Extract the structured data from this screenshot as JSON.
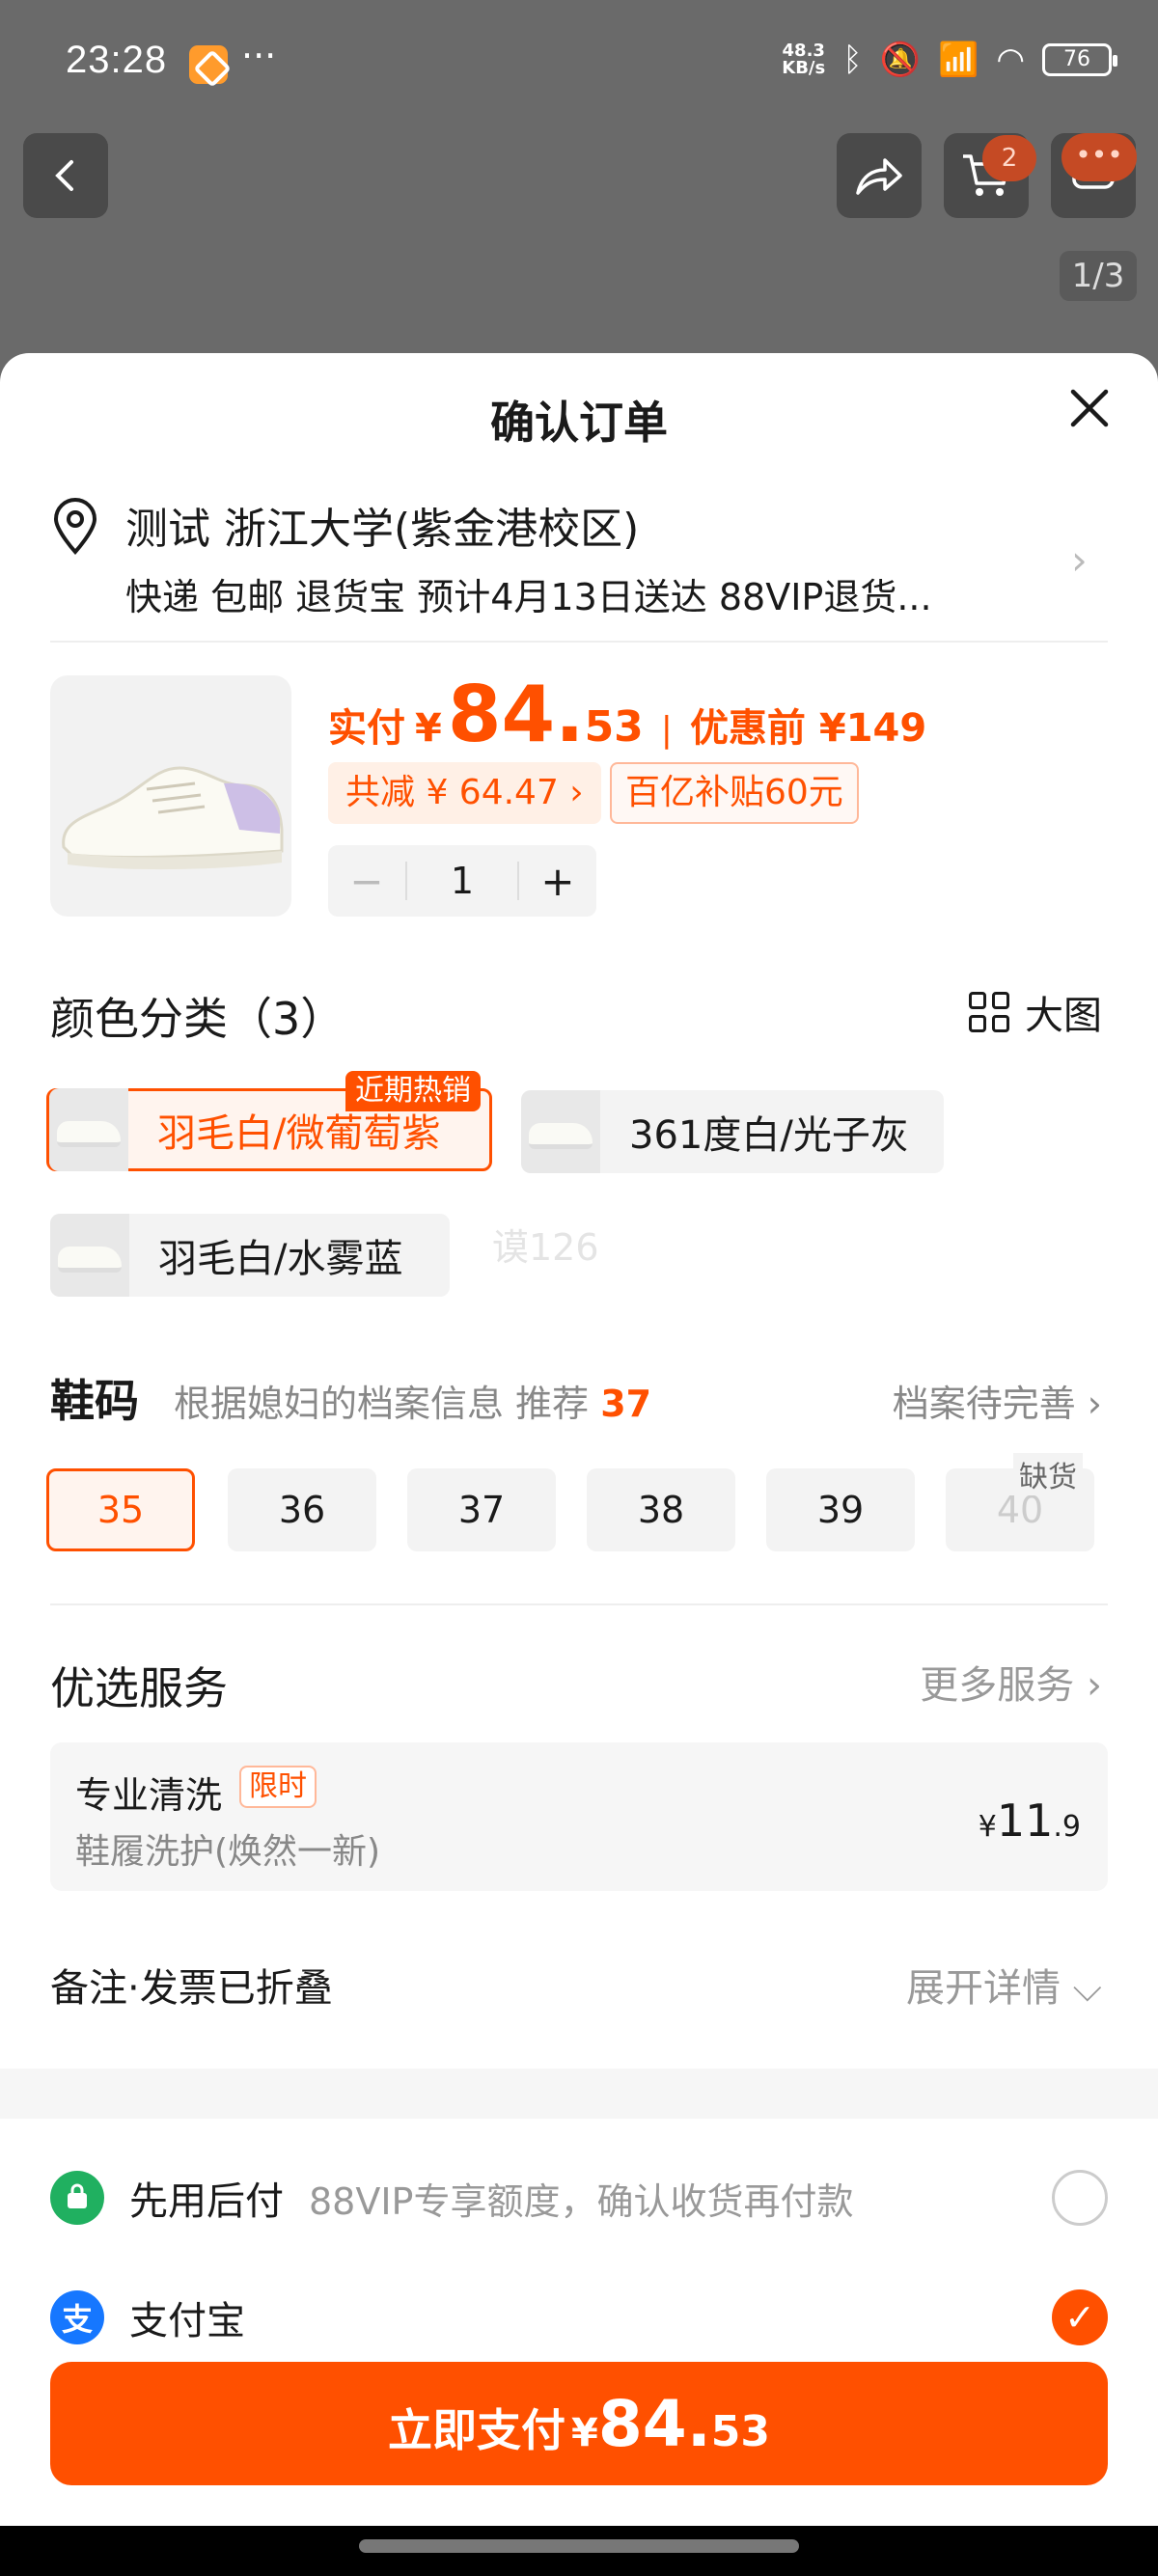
{
  "status_bar": {
    "time": "23:28",
    "dots": "···",
    "net_speed_value": "48.3",
    "net_speed_unit": "KB/s",
    "battery": "76"
  },
  "header": {
    "cart_count": "2",
    "image_counter": "1/3"
  },
  "sheet": {
    "title": "确认订单",
    "address": {
      "name": "测试 浙江大学(紫金港校区)",
      "delivery": "快递 包邮 退货宝 预计4月13日送达 88VIP退货..."
    },
    "product": {
      "paid_label": "实付",
      "currency": "¥",
      "paid_int": "84.",
      "paid_dec": "53",
      "separator": "|",
      "original": "优惠前 ¥149",
      "discount": "共减 ¥ 64.47 ›",
      "subsidy": "百亿补贴60元",
      "quantity": "1",
      "minus": "−",
      "plus": "+"
    },
    "color": {
      "title": "颜色分类（3）",
      "bigpic_label": "大图",
      "hot_tag": "近期热销",
      "options": [
        "羽毛白/微葡萄紫",
        "361度白/光子灰",
        "羽毛白/水雾蓝"
      ],
      "watermark": "谟126"
    },
    "size": {
      "label": "鞋码",
      "hint": "根据媳妇的档案信息 推荐",
      "recommended": "37",
      "profile_link": "档案待完善 ›",
      "oos_tag": "缺货",
      "options": [
        "35",
        "36",
        "37",
        "38",
        "39",
        "40"
      ]
    },
    "services": {
      "title": "优选服务",
      "more": "更多服务 ›",
      "item": {
        "name": "专业清洗",
        "tag": "限时",
        "desc": "鞋履洗护(焕然一新)",
        "price_yen": "¥",
        "price_int": "11",
        "price_dec": ".9"
      }
    },
    "notes": {
      "label": "备注·发票已折叠",
      "expand": "展开详情 ⌵"
    },
    "payment": {
      "methods": [
        {
          "name": "先用后付",
          "desc": "88VIP专享额度，确认收货再付款",
          "selected": false
        },
        {
          "name": "支付宝",
          "desc": "",
          "selected": true
        }
      ]
    },
    "pay_button": {
      "label": "立即支付",
      "currency": "¥",
      "amount_int": "84.",
      "amount_dec": "53"
    }
  },
  "colors": {
    "accent": "#ff5000",
    "sheet_bg": "#ffffff",
    "overlay": "#6a6a6a"
  },
  "icons": [
    "back-icon",
    "share-icon",
    "cart-icon",
    "message-icon",
    "close-icon",
    "location-pin-icon",
    "grid-icon",
    "chevron-right-icon",
    "radio-check-icon",
    "alipay-icon",
    "pay-later-icon"
  ]
}
